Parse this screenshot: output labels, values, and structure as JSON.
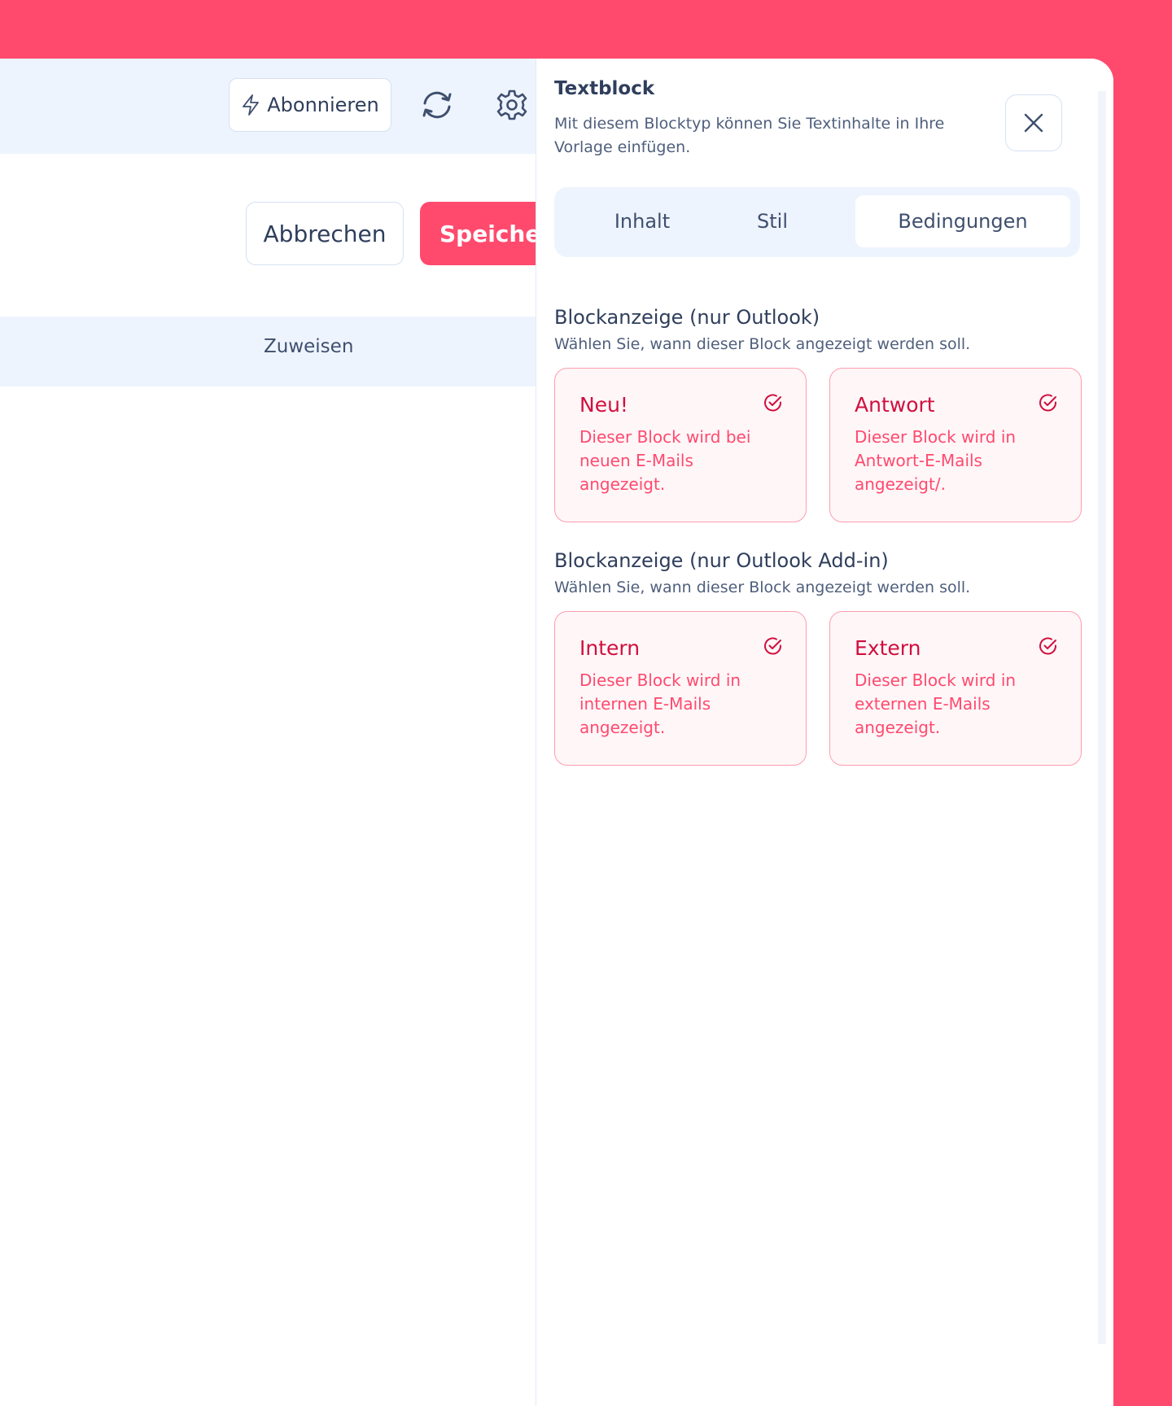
{
  "colors": {
    "brand": "#ff4a6e",
    "text": "#2f3e5c",
    "card_title": "#d0103e"
  },
  "header": {
    "subscribe_label": "Abonnieren",
    "subscribe_icon": "lightning-icon",
    "sync_icon": "sync-icon",
    "settings_icon": "gear-icon"
  },
  "actions": {
    "cancel_label": "Abbrechen",
    "save_label": "Speichern"
  },
  "assign": {
    "label": "Zuweisen"
  },
  "panel": {
    "title": "Textblock",
    "description": "Mit diesem Blocktyp können Sie Textinhalte in Ihre Vorlage einfügen.",
    "close_icon": "close-icon",
    "tabs": [
      {
        "label": "Inhalt",
        "active": false
      },
      {
        "label": "Stil",
        "active": false
      },
      {
        "label": "Bedingungen",
        "active": true
      }
    ],
    "sections": [
      {
        "title": "Blockanzeige (nur Outlook)",
        "subtitle": "Wählen Sie, wann dieser Block angezeigt werden soll.",
        "cards": [
          {
            "title": "Neu!",
            "text": "Dieser Block wird bei neuen E-Mails angezeigt.",
            "checked": true
          },
          {
            "title": "Antwort",
            "text": "Dieser Block wird in Antwort-E-Mails angezeigt/.",
            "checked": true
          }
        ]
      },
      {
        "title": "Blockanzeige (nur Outlook Add-in)",
        "subtitle": "Wählen Sie, wann dieser Block angezeigt werden soll.",
        "cards": [
          {
            "title": "Intern",
            "text": "Dieser Block wird in internen E-Mails angezeigt.",
            "checked": true
          },
          {
            "title": "Extern",
            "text": "Dieser Block wird in externen E-Mails angezeigt.",
            "checked": true
          }
        ]
      }
    ]
  }
}
